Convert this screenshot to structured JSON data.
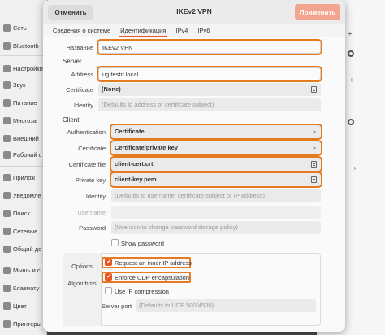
{
  "background": {
    "sidebar": [
      "Сеть",
      "Bluetooth",
      "Настройки",
      "Звук",
      "Питание",
      "Многоза",
      "Внешний",
      "Рабочий с",
      "Прилож",
      "Уведомле",
      "Поиск",
      "Сетевые",
      "Общий до",
      "Мышь и с",
      "Клавиату",
      "Цвет",
      "Принтеры"
    ]
  },
  "dialog": {
    "cancel": "Отменить",
    "title": "IKEv2 VPN",
    "apply": "Применить",
    "tabs": [
      "Сведения о системе",
      "Идентификация",
      "IPv4",
      "IPv6"
    ],
    "name_label": "Название",
    "name_value": "IKEv2 VPN",
    "server_section": "Server",
    "address_label": "Address",
    "address_value": "ug.testd.local",
    "certificate_label": "Certificate",
    "certificate_value": "(None)",
    "identity_label": "Identity",
    "identity_placeholder": "(Defaults to address or certificate subject)",
    "client_section": "Client",
    "auth_label": "Authentication",
    "auth_value": "Certificate",
    "client_cert_label": "Certificate",
    "client_cert_value": "Certificate/private key",
    "cert_file_label": "Certificate file",
    "cert_file_value": "client-cert.crt",
    "private_key_label": "Private key",
    "private_key_value": "client-key.pem",
    "client_identity_label": "Identity",
    "client_identity_placeholder": "(Defaults to username, certificate subject or IP address)",
    "username_label": "Username",
    "password_label": "Password",
    "password_placeholder": "(Use icon to change password storage policy)",
    "show_password": "Show password",
    "options_label": "Options",
    "algorithms_label": "Algorithms",
    "opt_inner_ip": "Request an inner IP address",
    "opt_udp_encap": "Enforce UDP encapsulation",
    "opt_ip_comp": "Use IP compression",
    "server_port_label": "Server port",
    "server_port_placeholder": "(Defaults to UDP 500/4500)"
  },
  "colors": {
    "accent": "#e95420",
    "highlight": "#e47b1f",
    "apply_button": "#f3a48e"
  }
}
